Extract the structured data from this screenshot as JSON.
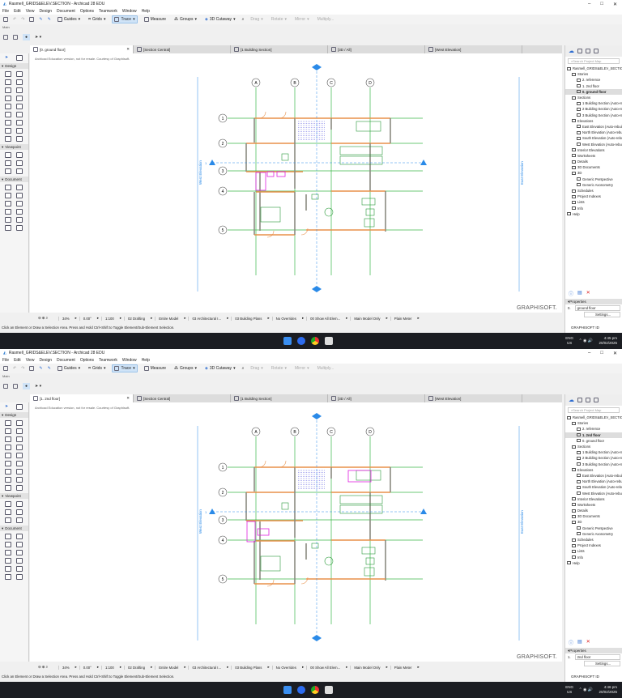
{
  "windows": [
    {
      "title": "Rasmell_GRIDS&ELEV.SECTION - Archicad 28 EDU",
      "active_tab": "[0. ground floor]",
      "story_value": "ground floor",
      "story_num": "0.",
      "clock_time": "4:45 pm"
    },
    {
      "title": "Rasmell_GRIDS&ELEV.SECTION - Archicad 28 EDU",
      "active_tab": "[1. 2nd floor]",
      "story_value": "2nd floor",
      "story_num": "1.",
      "clock_time": "4:46 pm"
    }
  ],
  "menu": [
    "File",
    "Edit",
    "View",
    "Design",
    "Document",
    "Options",
    "Teamwork",
    "Window",
    "Help"
  ],
  "toolbar": {
    "guides": "Guides",
    "grids": "Grids",
    "trace": "Trace",
    "measure": "Measure",
    "groups": "Groups",
    "cutaway": "3D Cutaway",
    "drag": "Drag",
    "rotate": "Rotate",
    "mirror": "Mirror",
    "multiply": "Multiply..."
  },
  "main_label": "Main",
  "tabs": [
    "[Section Central]",
    "[1 Building Section]",
    "[3D / All]",
    "[West Elevation]"
  ],
  "toolbox": {
    "design": "Design",
    "viewpoint": "Viewpoint",
    "document": "Document"
  },
  "edu_notice": "Archicad Education version, not for resale. Courtesy of Graphisoft.",
  "graphisoft": "GRAPHISOFT.",
  "plan": {
    "columns": [
      "A",
      "B",
      "C",
      "D"
    ],
    "rows": [
      "1",
      "2",
      "3",
      "4",
      "5"
    ],
    "west_elevation": "West Elevation",
    "east_elevation": "East Elevation",
    "section_marker": "1"
  },
  "navigator": {
    "search_placeholder": "Search Project Map",
    "tree": [
      {
        "label": "Rasmell_GRIDS&ELEV_SECTION",
        "level": 0
      },
      {
        "label": "Stories",
        "level": 1
      },
      {
        "label": "2. reference",
        "level": 2
      },
      {
        "label": "1. 2nd floor",
        "level": 2
      },
      {
        "label": "0. ground floor",
        "level": 2
      },
      {
        "label": "Sections",
        "level": 1
      },
      {
        "label": "1 Building Section (Auto-rebuild Model)",
        "level": 2
      },
      {
        "label": "2 Building Section (Auto-rebuild Model)",
        "level": 2
      },
      {
        "label": "3 Building Section (Auto-rebuild Model)",
        "level": 2
      },
      {
        "label": "Elevations",
        "level": 1
      },
      {
        "label": "East Elevation (Auto-rebuild Model)",
        "level": 2
      },
      {
        "label": "North Elevation (Auto-rebuild Model)",
        "level": 2
      },
      {
        "label": "South Elevation (Auto-rebuild Model)",
        "level": 2
      },
      {
        "label": "West Elevation (Auto-rebuild Model)",
        "level": 2
      },
      {
        "label": "Interior Elevations",
        "level": 1
      },
      {
        "label": "Worksheets",
        "level": 1
      },
      {
        "label": "Details",
        "level": 1
      },
      {
        "label": "3D Documents",
        "level": 1
      },
      {
        "label": "3D",
        "level": 1
      },
      {
        "label": "Generic Perspective",
        "level": 2
      },
      {
        "label": "Generic Axonometry",
        "level": 2
      },
      {
        "label": "Schedules",
        "level": 1
      },
      {
        "label": "Project Indexes",
        "level": 1
      },
      {
        "label": "Lists",
        "level": 1
      },
      {
        "label": "Info",
        "level": 1
      },
      {
        "label": "Help",
        "level": 0
      }
    ],
    "properties": "Properties",
    "settings": "Settings...",
    "graphisoft_id": "GRAPHISOFT ID"
  },
  "bottombar": [
    "34%",
    "0.00°",
    "1:100",
    "02 Drafting",
    "Entire Model",
    "03 Architectural I...",
    "03 Building Plans",
    "No Overrides",
    "00 Show All Elem...",
    "Main Model Only",
    "Plain Meter"
  ],
  "status": "Click an Element or Draw a Selection Area. Press and Hold Ctrl+Shift to Toggle Element/Sub-Element Selection.",
  "taskbar": {
    "lang1": "ENG",
    "lang2": "US",
    "date": "20/02/2025"
  },
  "colors": {
    "grid": "#3cb84a",
    "wall": "#e8904a",
    "furniture": "#2a9a3a",
    "stairs": "#5a5ae0",
    "sanitary": "#e020e0",
    "marker": "#2a8ae8"
  }
}
